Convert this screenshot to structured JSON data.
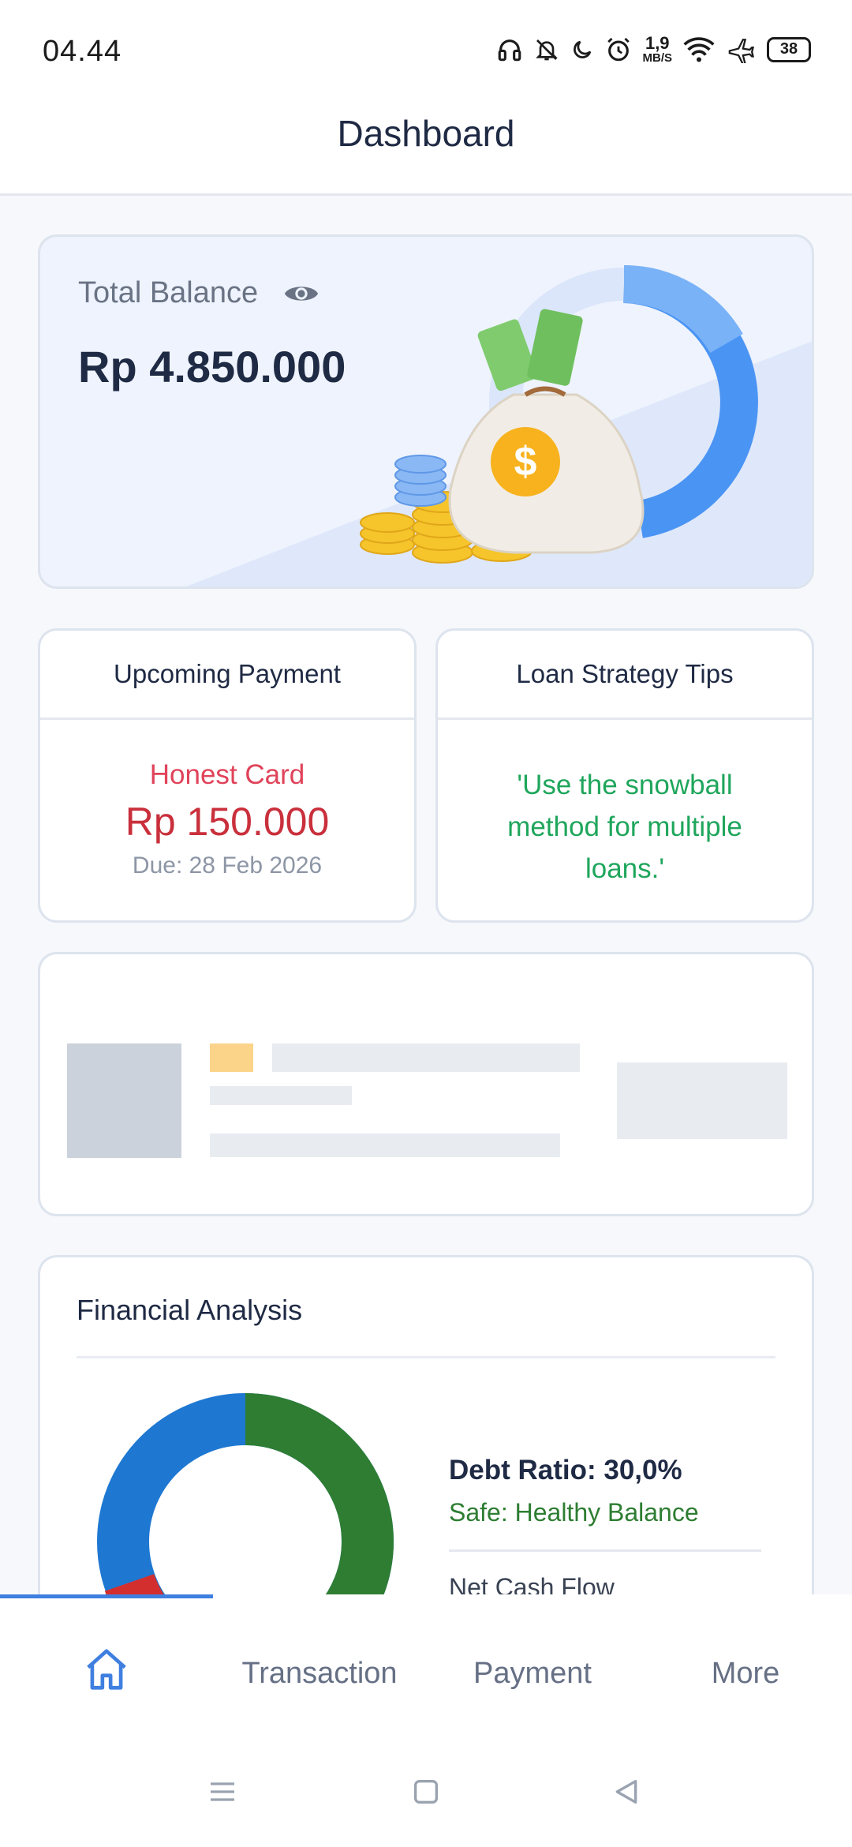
{
  "status_bar": {
    "time": "04.44",
    "net_speed_value": "1,9",
    "net_speed_unit": "MB/S",
    "battery": "38"
  },
  "header": {
    "title": "Dashboard"
  },
  "balance": {
    "label": "Total Balance",
    "value": "Rp 4.850.000"
  },
  "upcoming_payment": {
    "title": "Upcoming Payment",
    "name": "Honest Card",
    "amount": "Rp 150.000",
    "due": "Due: 28 Feb 2026"
  },
  "loan_tips": {
    "title": "Loan Strategy Tips",
    "tip": "'Use the snowball method for multiple loans.'"
  },
  "financial_analysis": {
    "title": "Financial Analysis",
    "debt_ratio": "Debt Ratio: 30,0%",
    "status": "Safe: Healthy Balance",
    "net_cash_flow_label": "Net Cash Flow"
  },
  "bottom_nav": {
    "items": [
      "Transaction",
      "Payment",
      "More"
    ],
    "active": "home"
  },
  "colors": {
    "accent": "#3f7fe0",
    "donut_green": "#2e7d32",
    "donut_blue": "#1e78d2",
    "donut_red": "#d32f2f",
    "danger": "#c9303c",
    "success": "#1fa65c"
  }
}
